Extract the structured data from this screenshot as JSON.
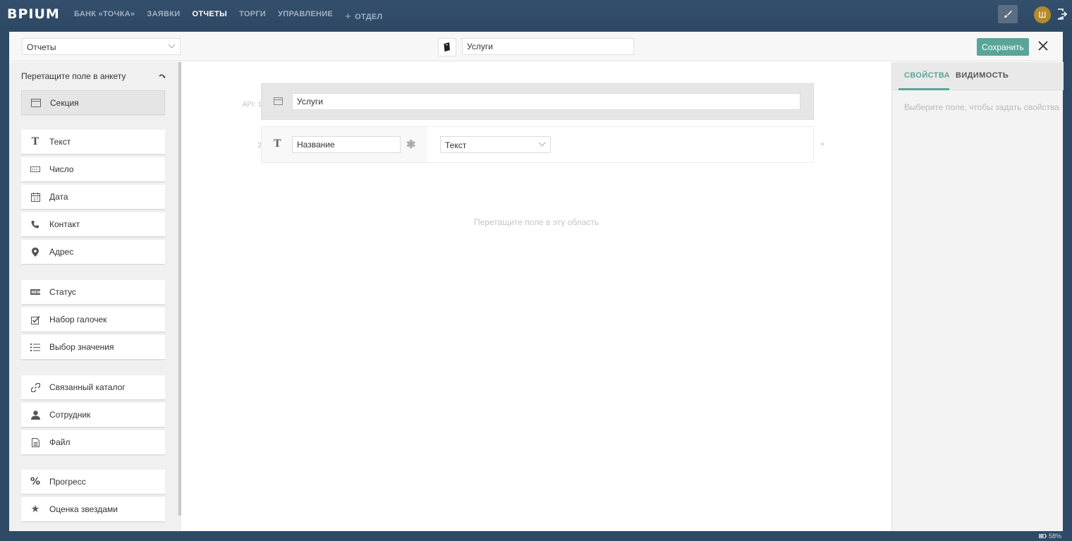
{
  "app": {
    "logo": "BPIUM",
    "nav": [
      {
        "label": "БАНК «ТОЧКА»"
      },
      {
        "label": "ЗАЯВКИ"
      },
      {
        "label": "ОТЧЕТЫ",
        "active": true
      },
      {
        "label": "ТОРГИ"
      },
      {
        "label": "УПРАВЛЕНИЕ"
      }
    ],
    "add_section_label": "ОТДЕЛ",
    "user_initial": "Ш",
    "tool_icon": "brush-icon",
    "logout_icon": "logout-icon"
  },
  "header": {
    "catalog_select": "Отчеты",
    "catalog_icon": "book-icon",
    "catalog_name": "Услуги",
    "save_label": "Сохранить"
  },
  "palette": {
    "title": "Перетащите поле в анкету",
    "items": [
      {
        "label": "Секция",
        "icon": "section-icon"
      },
      {
        "label": "Текст",
        "icon": "text-icon"
      },
      {
        "label": "Число",
        "icon": "number-icon"
      },
      {
        "label": "Дата",
        "icon": "calendar-icon"
      },
      {
        "label": "Контакт",
        "icon": "phone-icon"
      },
      {
        "label": "Адрес",
        "icon": "location-icon"
      },
      {
        "label": "Статус",
        "icon": "status-icon"
      },
      {
        "label": "Набор галочек",
        "icon": "checkbox-icon"
      },
      {
        "label": "Выбор значения",
        "icon": "list-icon"
      },
      {
        "label": "Связанный каталог",
        "icon": "link-icon"
      },
      {
        "label": "Сотрудник",
        "icon": "user-icon"
      },
      {
        "label": "Файл",
        "icon": "file-icon"
      },
      {
        "label": "Прогресс",
        "icon": "percent-icon"
      },
      {
        "label": "Оценка звездами",
        "icon": "star-icon"
      }
    ]
  },
  "canvas": {
    "section_row": {
      "api_label": "API: 1",
      "value": "Услуги"
    },
    "field_row": {
      "num": "2",
      "name": "Название",
      "type": "Текст"
    },
    "remove_glyph": "×",
    "drop_hint": "Перетащите поле в эту область"
  },
  "props": {
    "tabs": [
      "СВОЙСТВА",
      "ВИДИМОСТЬ"
    ],
    "active_tab": 0,
    "hint": "Выберите поле, чтобы задать свойства"
  },
  "status": {
    "battery": "58%"
  },
  "colors": {
    "topbar": "#2f4a66",
    "accent": "#5aa59a",
    "avatar": "#b38a2a"
  }
}
